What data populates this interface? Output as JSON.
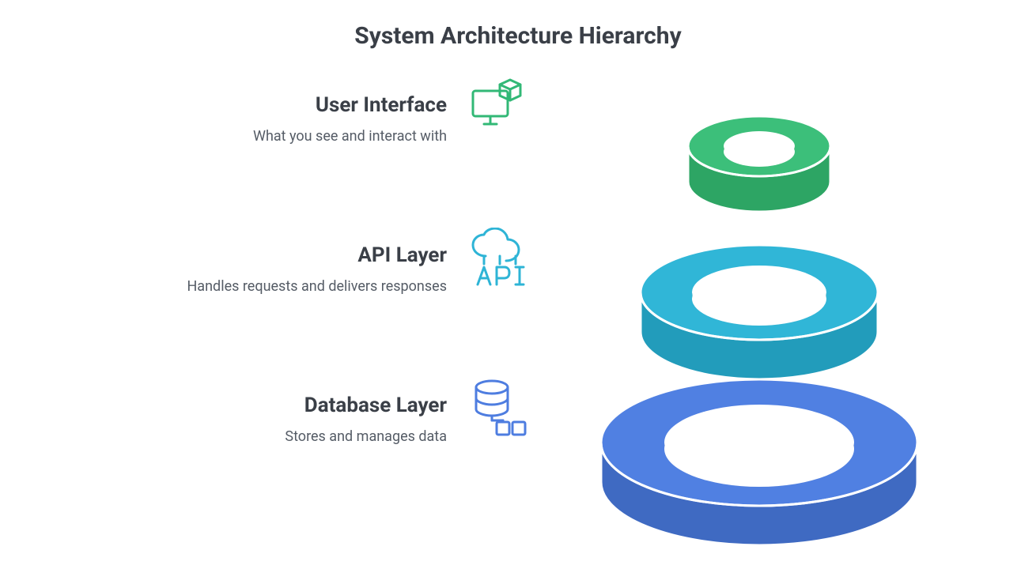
{
  "title": "System Architecture Hierarchy",
  "layers": [
    {
      "title": "User Interface",
      "desc": "What you see and interact with",
      "icon": "monitor-cube-icon",
      "color": "#32b876"
    },
    {
      "title": "API Layer",
      "desc": "Handles requests and delivers responses",
      "icon": "cloud-api-icon",
      "color": "#2eb4d6"
    },
    {
      "title": "Database Layer",
      "desc": "Stores and manages data",
      "icon": "database-icon",
      "color": "#4e7de0"
    }
  ],
  "palette": {
    "green": "#3cbf7a",
    "greenDark": "#2da564",
    "teal": "#30b6d7",
    "tealDark": "#229cbb",
    "blue": "#5080e2",
    "blueDark": "#3f6ac2",
    "text": "#3a3f47"
  }
}
